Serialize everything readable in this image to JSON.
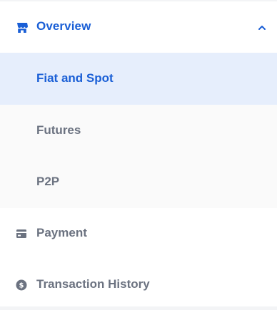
{
  "colors": {
    "accent": "#1a5fd6",
    "muted_text": "#6b7280",
    "active_bg": "#e6eefc",
    "submenu_bg": "#fafafa"
  },
  "overview": {
    "label": "Overview",
    "icon": "store-icon",
    "expanded": true,
    "chevron_icon": "chevron-up-icon",
    "items": [
      {
        "label": "Fiat and Spot",
        "active": true
      },
      {
        "label": "Futures",
        "active": false
      },
      {
        "label": "P2P",
        "active": false
      }
    ]
  },
  "nav": [
    {
      "label": "Payment",
      "icon": "payment-card-icon"
    },
    {
      "label": "Transaction History",
      "icon": "dollar-coin-icon"
    }
  ]
}
